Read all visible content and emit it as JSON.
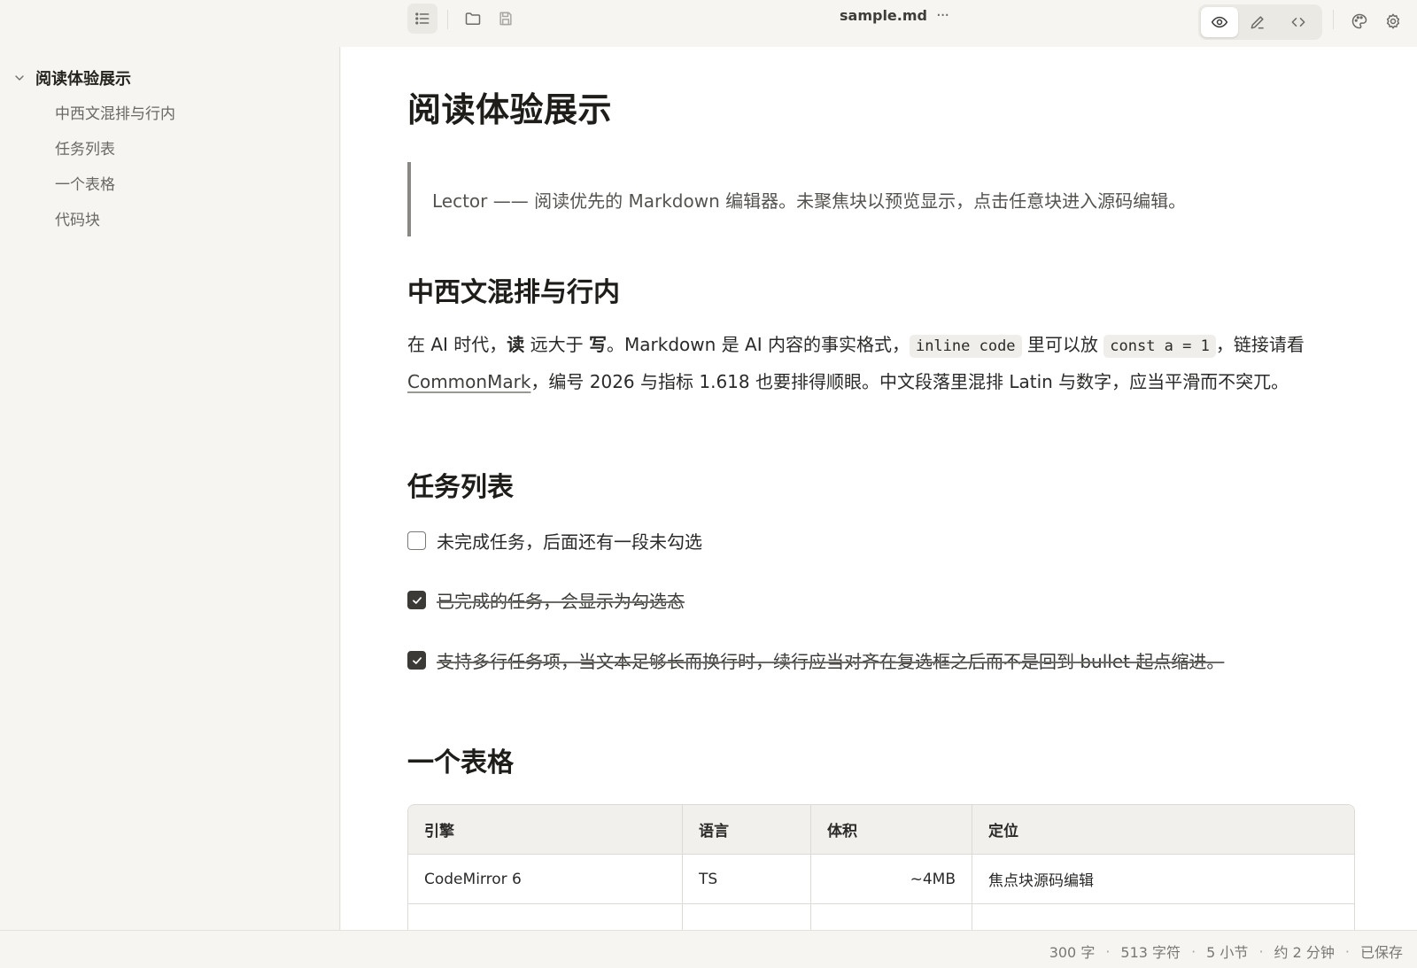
{
  "toolbar": {
    "filename": "sample.md",
    "more": "···"
  },
  "sidebar": {
    "root": "阅读体验展示",
    "items": [
      "中西文混排与行内",
      "任务列表",
      "一个表格",
      "代码块"
    ]
  },
  "doc": {
    "title": "阅读体验展示",
    "quote": "Lector —— 阅读优先的 Markdown 编辑器。未聚焦块以预览显示，点击任意块进入源码编辑。",
    "section1": {
      "heading": "中西文混排与行内",
      "p1": "在 AI 时代，",
      "b1": "读",
      "p2": " 远大于 ",
      "b2": "写",
      "p3": "。Markdown 是 AI 内容的事实格式，",
      "code1": "inline code",
      "p4": " 里可以放 ",
      "code2": "const a = 1",
      "p5": "，链接请看 ",
      "link": "CommonMark",
      "p6": "，编号 2026 与指标 1.618 也要排得顺眼。中文段落里混排 Latin 与数字，应当平滑而不突兀。"
    },
    "section2": {
      "heading": "任务列表",
      "tasks": [
        {
          "text": "未完成任务，后面还有一段未勾选",
          "done": false
        },
        {
          "text": "已完成的任务，会显示为勾选态",
          "done": true
        },
        {
          "text": "支持多行任务项，当文本足够长而换行时，续行应当对齐在复选框之后而不是回到 bullet 起点缩进。",
          "done": true
        }
      ]
    },
    "section3": {
      "heading": "一个表格",
      "columns": [
        "引擎",
        "语言",
        "体积",
        "定位"
      ],
      "rows": [
        [
          "CodeMirror 6",
          "TS",
          "~4MB",
          "焦点块源码编辑"
        ]
      ]
    }
  },
  "status": {
    "words": "300 字",
    "chars": "513 字符",
    "sections": "5 小节",
    "time": "约 2 分钟",
    "saved": "已保存"
  }
}
